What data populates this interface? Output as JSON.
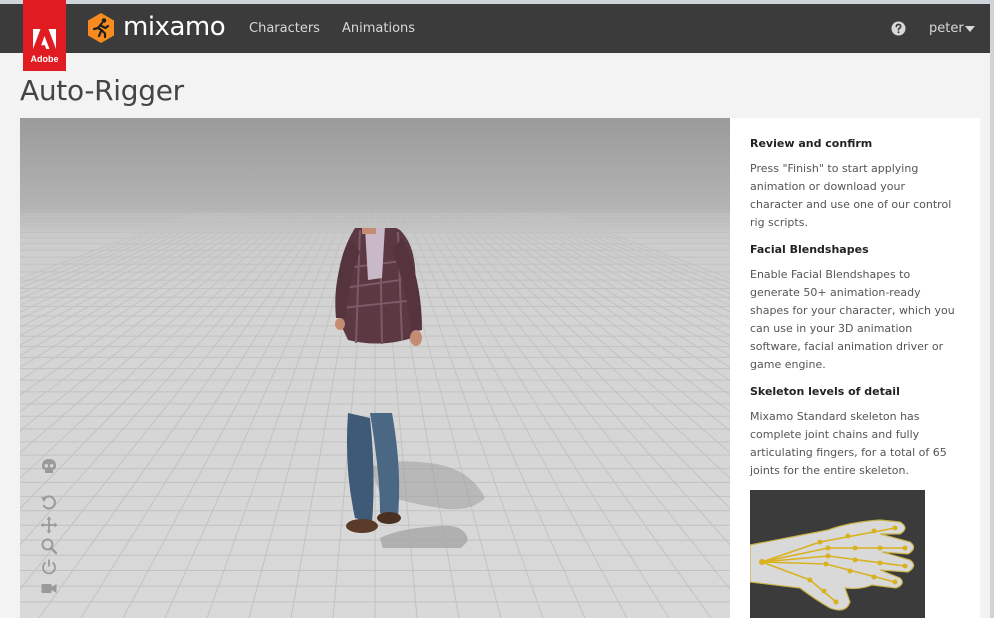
{
  "app": {
    "adobe_label": "Adobe",
    "brand_name": "mixamo",
    "brand_color": "#f68b1f",
    "adobe_red": "#e11b22"
  },
  "nav": {
    "links": [
      {
        "label": "Characters"
      },
      {
        "label": "Animations"
      }
    ],
    "help_icon": "question-circle-icon",
    "user": "peter"
  },
  "page": {
    "title": "Auto-Rigger"
  },
  "viewer": {
    "controls": [
      "skull-icon",
      "rotate-icon",
      "move-icon",
      "zoom-icon",
      "power-icon",
      "camera-icon"
    ]
  },
  "info": {
    "sections": [
      {
        "heading": "Review and confirm",
        "body": "Press \"Finish\" to start applying animation or download your character and use one of our control rig scripts."
      },
      {
        "heading": "Facial Blendshapes",
        "body": "Enable Facial Blendshapes to generate 50+ animation-ready shapes for your character, which you can use in your 3D animation software, facial animation driver or game engine."
      },
      {
        "heading": "Skeleton levels of detail",
        "body": "Mixamo Standard skeleton has complete joint chains and fully articulating fingers, for a total of 65 joints for the entire skeleton."
      }
    ]
  }
}
